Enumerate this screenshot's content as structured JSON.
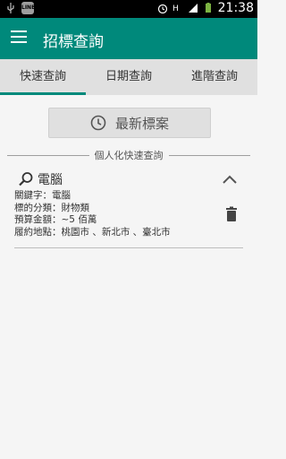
{
  "statusbar": {
    "time": "21:38",
    "line_badge": "LINE"
  },
  "appbar": {
    "title": "招標查詢"
  },
  "tabs": [
    {
      "label": "快速查詢",
      "active": true
    },
    {
      "label": "日期查詢",
      "active": false
    },
    {
      "label": "進階查詢",
      "active": false
    }
  ],
  "latest_button": {
    "label": "最新標案"
  },
  "section": {
    "label": "個人化快速查詢"
  },
  "saved_query": {
    "title": "電腦",
    "lines": [
      "關鍵字：電腦",
      "標的分類：財物類",
      "預算金額：~5 佰萬",
      "履約地點：桃園市 、新北市 、臺北市"
    ]
  },
  "colors": {
    "primary": "#00897b",
    "tabs_bg": "#e0e0e0"
  }
}
